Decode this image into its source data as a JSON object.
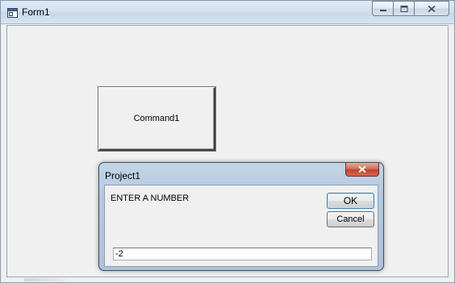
{
  "window": {
    "title": "Form1"
  },
  "command_button": {
    "label": "Command1"
  },
  "input_dialog": {
    "title": "Project1",
    "prompt": "ENTER A NUMBER",
    "ok_label": "OK",
    "cancel_label": "Cancel",
    "input_value": "-2"
  },
  "icons": {
    "app": "form-window-icon",
    "minimize": "minimize-icon",
    "maximize": "maximize-icon",
    "close": "close-icon"
  },
  "colors": {
    "client_background": "#f0f0f0",
    "dialog_close_accent": "#c2412b",
    "ok_focus_border": "#3c7fb1"
  }
}
